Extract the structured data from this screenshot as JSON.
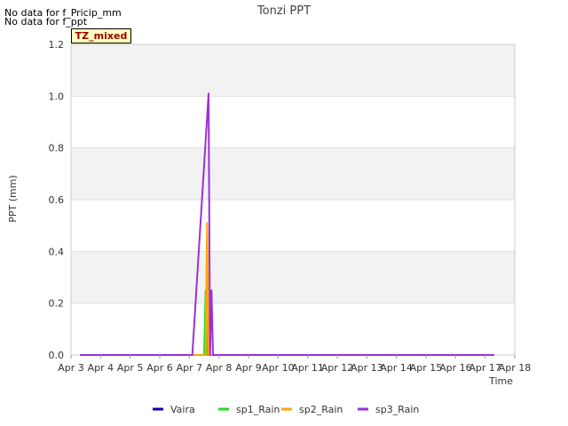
{
  "notes": [
    "No data for f_Pricip_mm",
    "No data for f_ppt"
  ],
  "tz_badge": "TZ_mixed",
  "chart_data": {
    "type": "line",
    "title": "Tonzi PPT",
    "xlabel": "Time",
    "ylabel": "PPT (mm)",
    "ylim": [
      0,
      1.2
    ],
    "yticks": [
      0.0,
      0.2,
      0.4,
      0.6,
      0.8,
      1.0,
      1.2
    ],
    "ytick_labels": [
      "0.0",
      "0.2",
      "0.4",
      "0.6",
      "0.8",
      "1.0",
      "1.2"
    ],
    "xlim": [
      3,
      18
    ],
    "xticks": [
      3,
      4,
      5,
      6,
      7,
      8,
      9,
      10,
      11,
      12,
      13,
      14,
      15,
      16,
      17,
      18
    ],
    "xtick_labels": [
      "Apr 3",
      "Apr 4",
      "Apr 5",
      "Apr 6",
      "Apr 7",
      "Apr 8",
      "Apr 9",
      "Apr 10",
      "Apr 11",
      "Apr 12",
      "Apr 13",
      "Apr 14",
      "Apr 15",
      "Apr 16",
      "Apr 17",
      "Apr 18"
    ],
    "x_units": "day of April",
    "grid": true,
    "legend_position": "bottom",
    "series": [
      {
        "name": "Vaira",
        "color": "#0000bb",
        "points": []
      },
      {
        "name": "sp1_Rain",
        "color": "#22dd22",
        "points": [
          [
            3.3,
            0
          ],
          [
            7.5,
            0
          ],
          [
            7.55,
            0.25
          ],
          [
            7.6,
            0
          ],
          [
            17.3,
            0
          ]
        ]
      },
      {
        "name": "sp2_Rain",
        "color": "#ffa500",
        "points": [
          [
            3.3,
            0
          ],
          [
            7.55,
            0
          ],
          [
            7.6,
            0.51
          ],
          [
            7.65,
            0
          ],
          [
            17.3,
            0
          ]
        ]
      },
      {
        "name": "sp3_Rain",
        "color": "#9b30d9",
        "points": [
          [
            3.3,
            0
          ],
          [
            7.1,
            0
          ],
          [
            7.65,
            1.01
          ],
          [
            7.7,
            0
          ],
          [
            7.75,
            0.25
          ],
          [
            7.8,
            0
          ],
          [
            17.3,
            0
          ]
        ]
      }
    ]
  }
}
